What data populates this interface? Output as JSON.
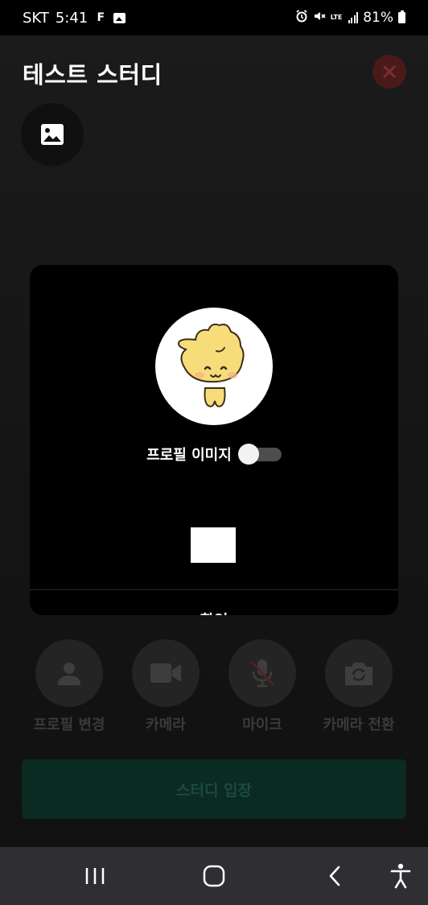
{
  "status_bar": {
    "carrier": "SKT",
    "time": "5:41",
    "notif_f": "F",
    "lte": "LTE",
    "battery": "81%"
  },
  "header": {
    "title": "테스트 스터디"
  },
  "modal": {
    "toggle_label": "프로필 이미지",
    "toggle_on": false,
    "confirm_label": "확인"
  },
  "controls": [
    {
      "label": "프로필 변경",
      "icon": "person-icon"
    },
    {
      "label": "카메라",
      "icon": "video-camera-icon"
    },
    {
      "label": "마이크",
      "icon": "mic-off-icon"
    },
    {
      "label": "카메라 전환",
      "icon": "camera-switch-icon"
    }
  ],
  "enter_button": {
    "label": "스터디 입장"
  },
  "colors": {
    "accent_green": "#0b2a22",
    "close_bg": "#4a1a1a"
  }
}
